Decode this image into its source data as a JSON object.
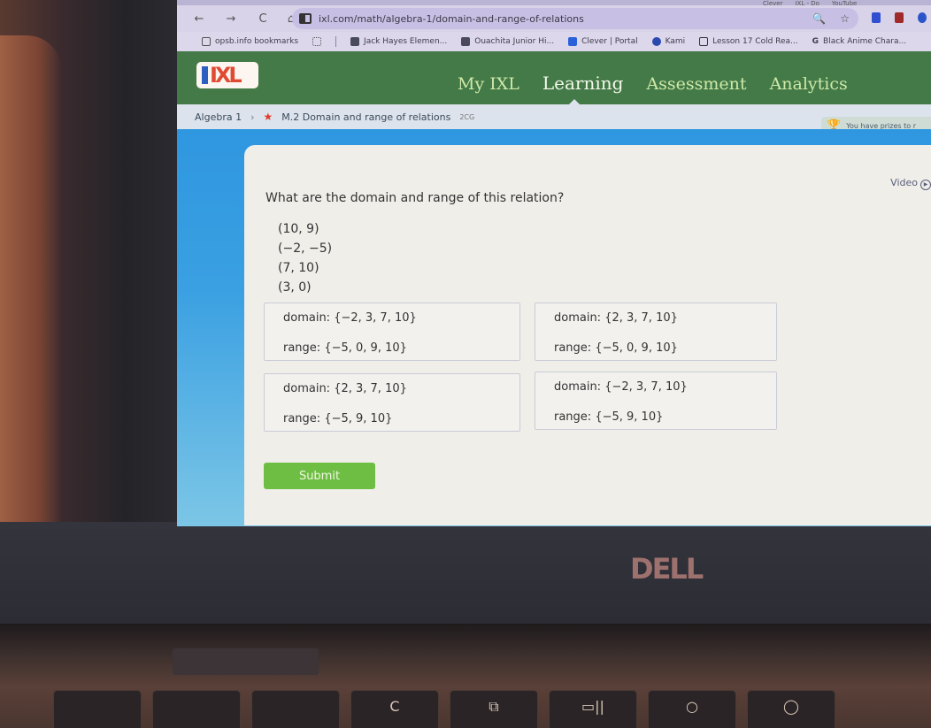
{
  "browser": {
    "tabs": [
      {
        "label": "Clever"
      },
      {
        "label": "IXL - Do"
      },
      {
        "label": "YouTube"
      }
    ],
    "nav": {
      "back": "←",
      "forward": "→",
      "reload": "C",
      "home": "⌂"
    },
    "url": "ixl.com/math/algebra-1/domain-and-range-of-relations",
    "omnibox_icons": {
      "zoom": "🔍",
      "bookmark": "☆"
    },
    "bookmarks": [
      {
        "label": "opsb.info bookmarks",
        "icon": "folder-icon"
      },
      {
        "label": "Jack Hayes Elemen...",
        "icon": "school-icon"
      },
      {
        "label": "Ouachita Junior Hi...",
        "icon": "school-icon"
      },
      {
        "label": "Clever | Portal",
        "icon": "clever-icon"
      },
      {
        "label": "Kami",
        "icon": "kami-icon"
      },
      {
        "label": "Lesson 17 Cold Rea...",
        "icon": "doc-icon"
      },
      {
        "label": "Black Anime Chara...",
        "icon": "google-icon"
      }
    ]
  },
  "ixl": {
    "logo": "IXL",
    "nav": [
      {
        "label": "My IXL",
        "active": false
      },
      {
        "label": "Learning",
        "active": true
      },
      {
        "label": "Assessment",
        "active": false
      },
      {
        "label": "Analytics",
        "active": false
      }
    ],
    "breadcrumb": {
      "course": "Algebra 1",
      "separator": "›",
      "star": "★",
      "skill": "M.2 Domain and range of relations",
      "code": "2CG"
    },
    "prize_text": "You have prizes to r",
    "video_label": "Video",
    "question": "What are the domain and range of this relation?",
    "pairs": [
      "(10, 9)",
      "(−2, −5)",
      "(7, 10)",
      "(3, 0)"
    ],
    "choices": [
      {
        "domain": "domain: {−2, 3, 7, 10}",
        "range": "range: {−5, 0, 9, 10}"
      },
      {
        "domain": "domain: {2, 3, 7, 10}",
        "range": "range: {−5, 0, 9, 10}"
      },
      {
        "domain": "domain: {2, 3, 7, 10}",
        "range": "range: {−5, 9, 10}"
      },
      {
        "domain": "domain: {−2, 3, 7, 10}",
        "range": "range: {−5, 9, 10}"
      }
    ],
    "submit_label": "Submit"
  },
  "hardware": {
    "brand": "DELL",
    "keys": [
      "",
      "",
      "",
      "C",
      "⧉",
      "▭||",
      "○",
      "◯"
    ]
  },
  "colors": {
    "ixl_green": "#437a47",
    "submit_green": "#6fbe44",
    "band_blue": "#2f97e0"
  }
}
